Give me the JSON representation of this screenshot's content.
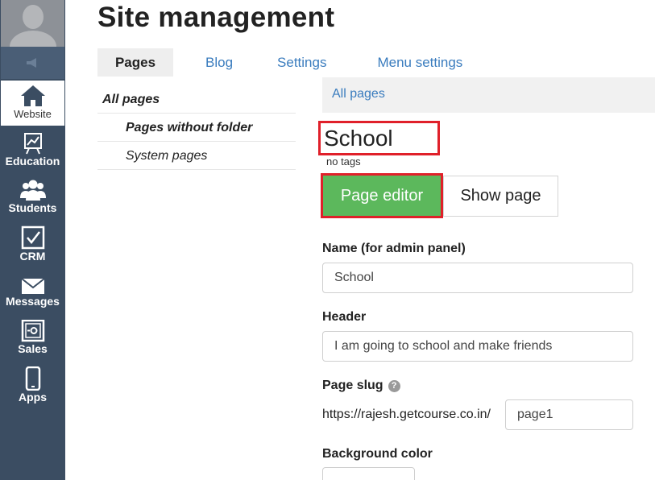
{
  "sidebar": {
    "items": [
      {
        "label": "Website",
        "icon": "house-icon",
        "active": true
      },
      {
        "label": "Education",
        "icon": "chart-board-icon"
      },
      {
        "label": "Students",
        "icon": "users-icon"
      },
      {
        "label": "CRM",
        "icon": "checkbox-icon"
      },
      {
        "label": "Messages",
        "icon": "envelope-icon"
      },
      {
        "label": "Sales",
        "icon": "safe-icon"
      },
      {
        "label": "Apps",
        "icon": "smartphone-icon"
      }
    ]
  },
  "header": {
    "title": "Site management",
    "tabs": [
      {
        "label": "Pages",
        "active": true
      },
      {
        "label": "Blog"
      },
      {
        "label": "Settings"
      },
      {
        "label": "Menu settings"
      }
    ]
  },
  "folders": [
    {
      "label": "All pages"
    },
    {
      "label": "Pages without folder"
    },
    {
      "label": "System pages"
    }
  ],
  "breadcrumb": "All pages",
  "page": {
    "name": "School",
    "tags": "no tags",
    "editor_button": "Page editor",
    "show_button": "Show page"
  },
  "form": {
    "name_label": "Name (for admin panel)",
    "name_value": "School",
    "header_label": "Header",
    "header_value": "I am going to school and make friends",
    "slug_label": "Page slug",
    "slug_prefix": "https://rajesh.getcourse.co.in/",
    "slug_value": "page1",
    "bg_label": "Background color"
  },
  "colors": {
    "sidebar": "#3b4d62",
    "accent_green": "#5cb85c",
    "highlight_red": "#e0202a",
    "link_blue": "#3a7cbe"
  }
}
